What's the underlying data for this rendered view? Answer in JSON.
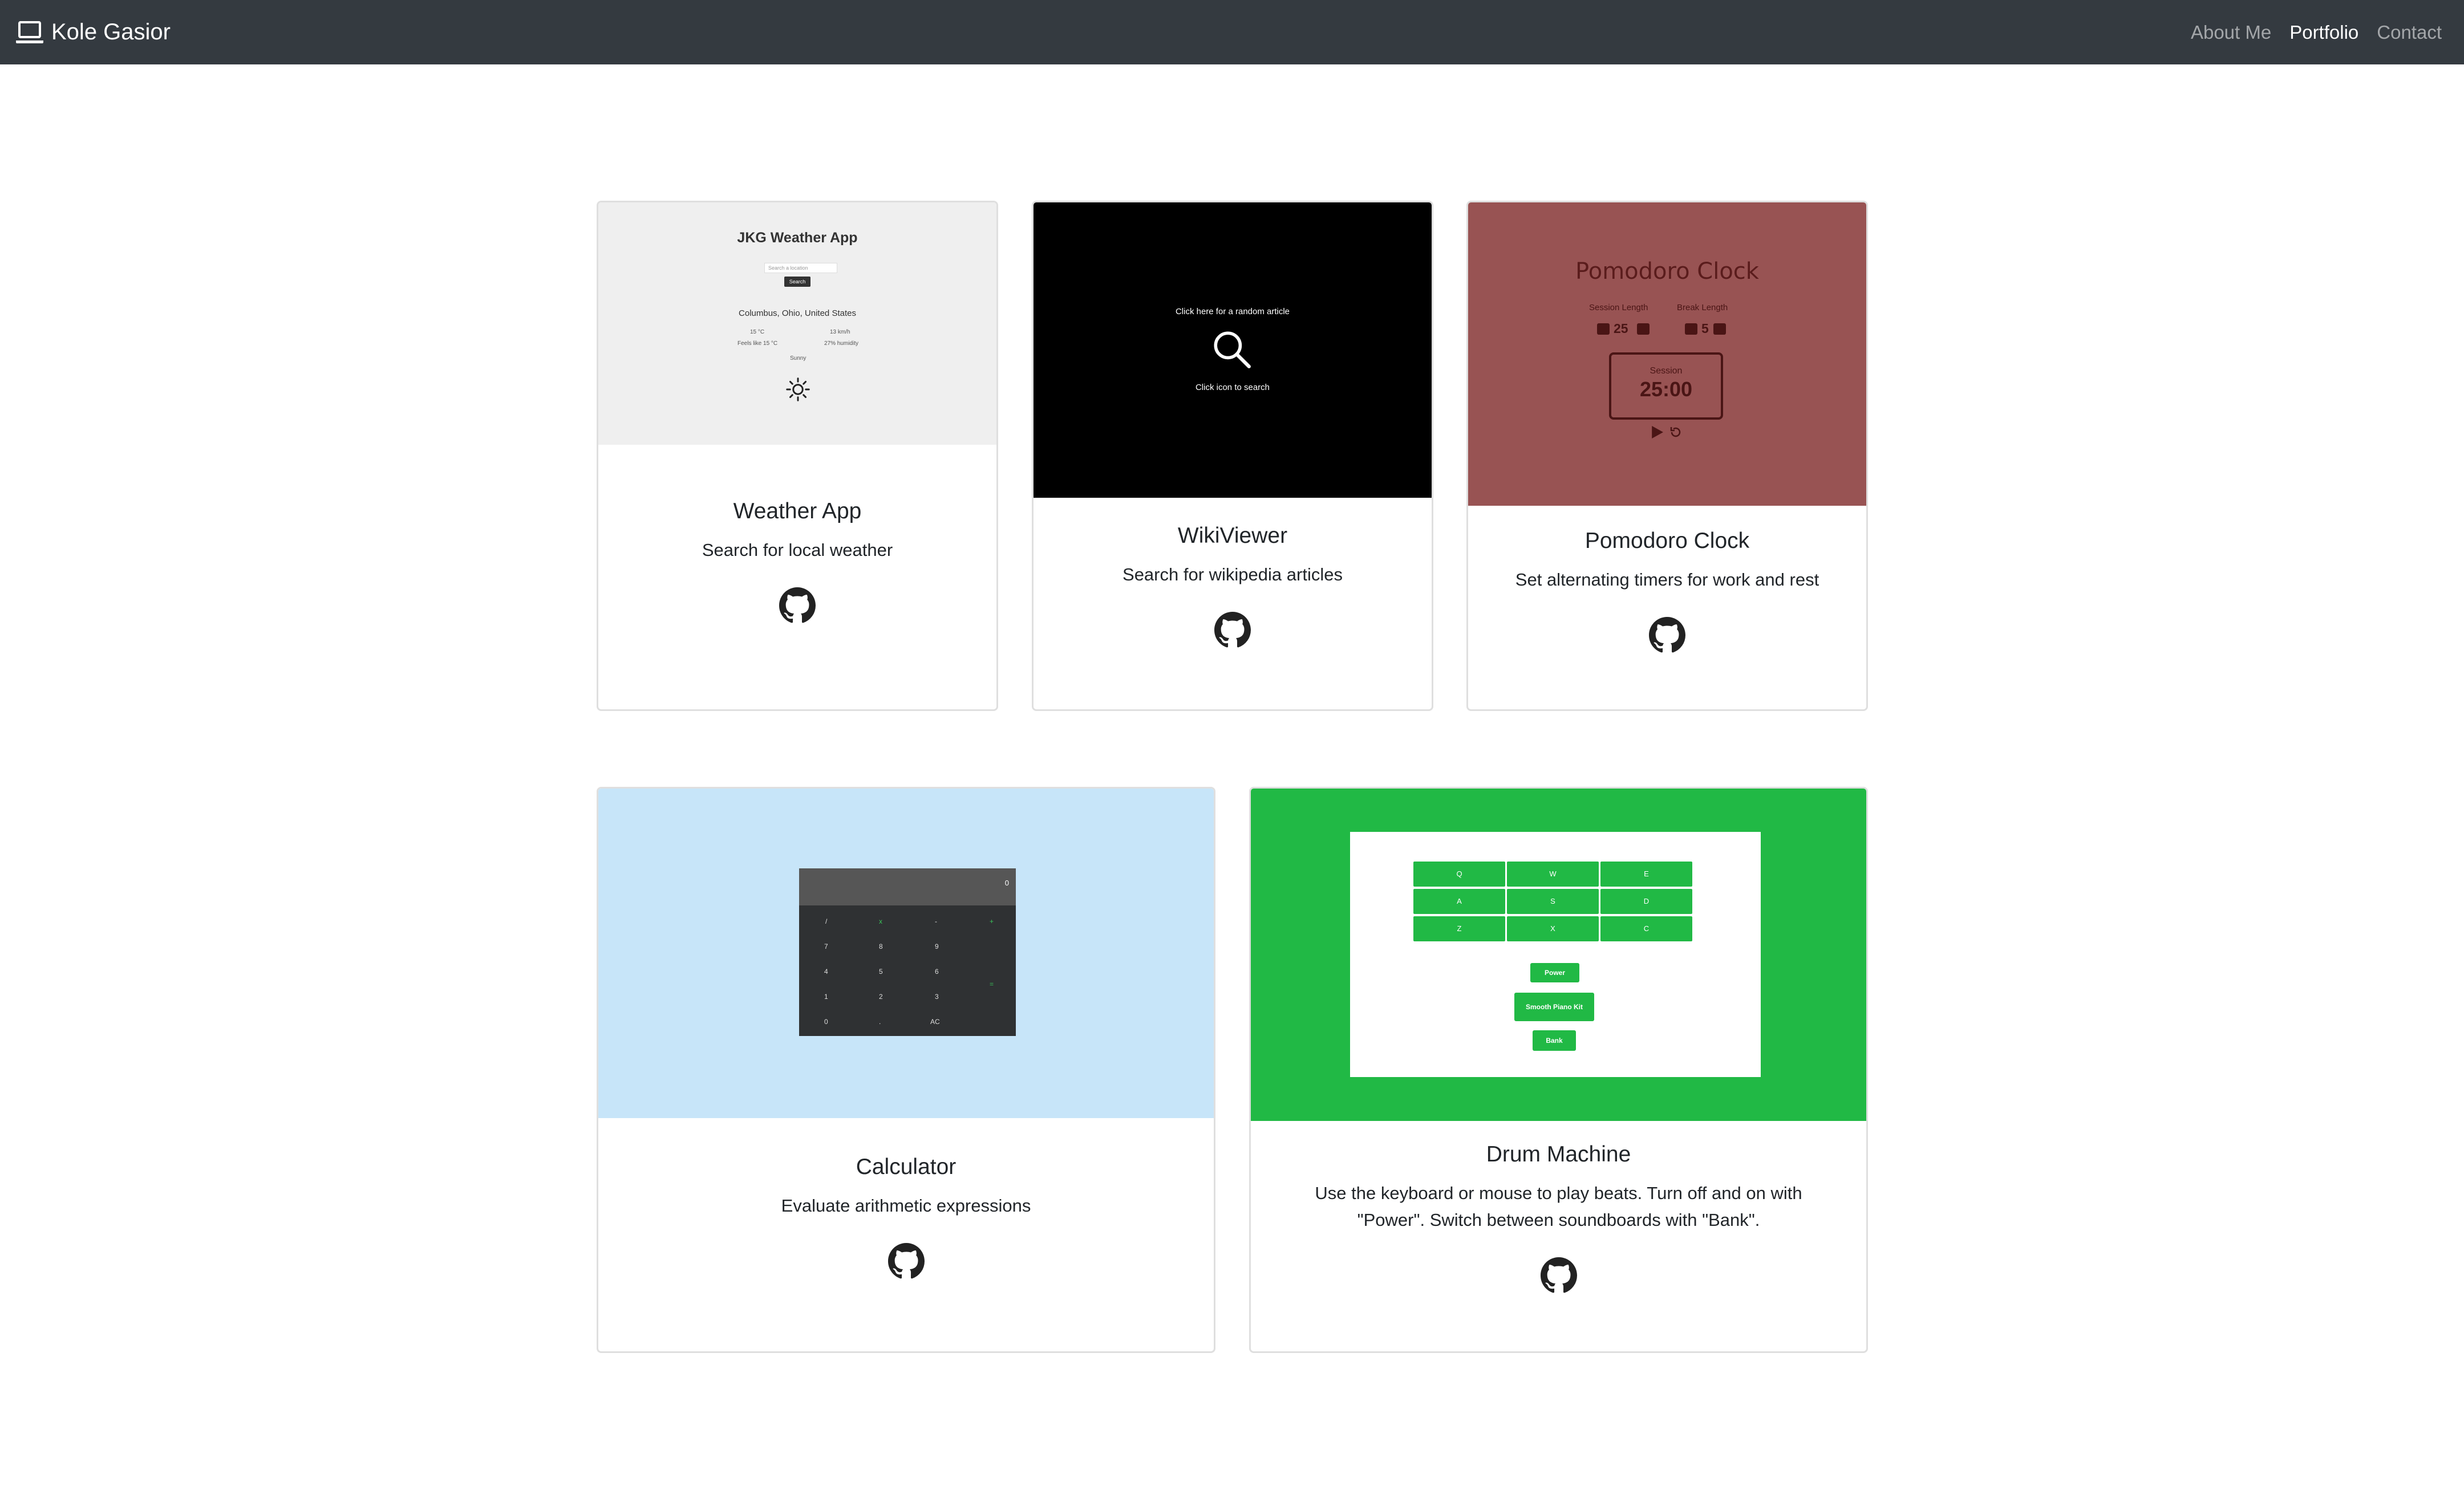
{
  "navbar": {
    "brand": "Kole Gasior",
    "links": [
      {
        "label": "About Me",
        "active": false
      },
      {
        "label": "Portfolio",
        "active": true
      },
      {
        "label": "Contact",
        "active": false
      }
    ]
  },
  "projects": [
    {
      "title": "Weather App",
      "description": "Search for local weather",
      "preview": {
        "heading": "JKG Weather App",
        "search_placeholder": "Search a location",
        "search_button": "Search",
        "location": "Columbus, Ohio, United States",
        "temp": "15 °C",
        "wind": "13 km/h",
        "feels_like": "Feels like 15 °C",
        "humidity": "27% humidity",
        "condition": "Sunny"
      }
    },
    {
      "title": "WikiViewer",
      "description": "Search for wikipedia articles",
      "preview": {
        "random_text": "Click here for a random article",
        "search_text": "Click icon to search"
      }
    },
    {
      "title": "Pomodoro Clock",
      "description": "Set alternating timers for work and rest",
      "preview": {
        "heading": "Pomodoro Clock",
        "session_label": "Session Length",
        "break_label": "Break Length",
        "session_value": "25",
        "break_value": "5",
        "timer_label": "Session",
        "timer_value": "25:00"
      }
    },
    {
      "title": "Calculator",
      "description": "Evaluate arithmetic expressions",
      "preview": {
        "display": "0",
        "keys": [
          "/",
          "x",
          "-",
          "+",
          "7",
          "8",
          "9",
          "4",
          "5",
          "6",
          "=",
          "1",
          "2",
          "3",
          "0",
          ".",
          "AC"
        ]
      }
    },
    {
      "title": "Drum Machine",
      "description": "Use the keyboard or mouse to play beats. Turn off and on with \"Power\". Switch between soundboards with \"Bank\".",
      "preview": {
        "pads": [
          "Q",
          "W",
          "E",
          "A",
          "S",
          "D",
          "Z",
          "X",
          "C"
        ],
        "power": "Power",
        "kit": "Smooth Piano Kit",
        "bank": "Bank"
      }
    }
  ],
  "colors": {
    "navbar": "#343a40",
    "weather_bg": "#efefef",
    "wiki_bg": "#000000",
    "pomodoro_bg": "#985353",
    "calculator_bg": "#c7e5f9",
    "drum_bg": "#21b945"
  },
  "icons": {
    "brand": "laptop-icon",
    "project_link": "github-icon"
  }
}
